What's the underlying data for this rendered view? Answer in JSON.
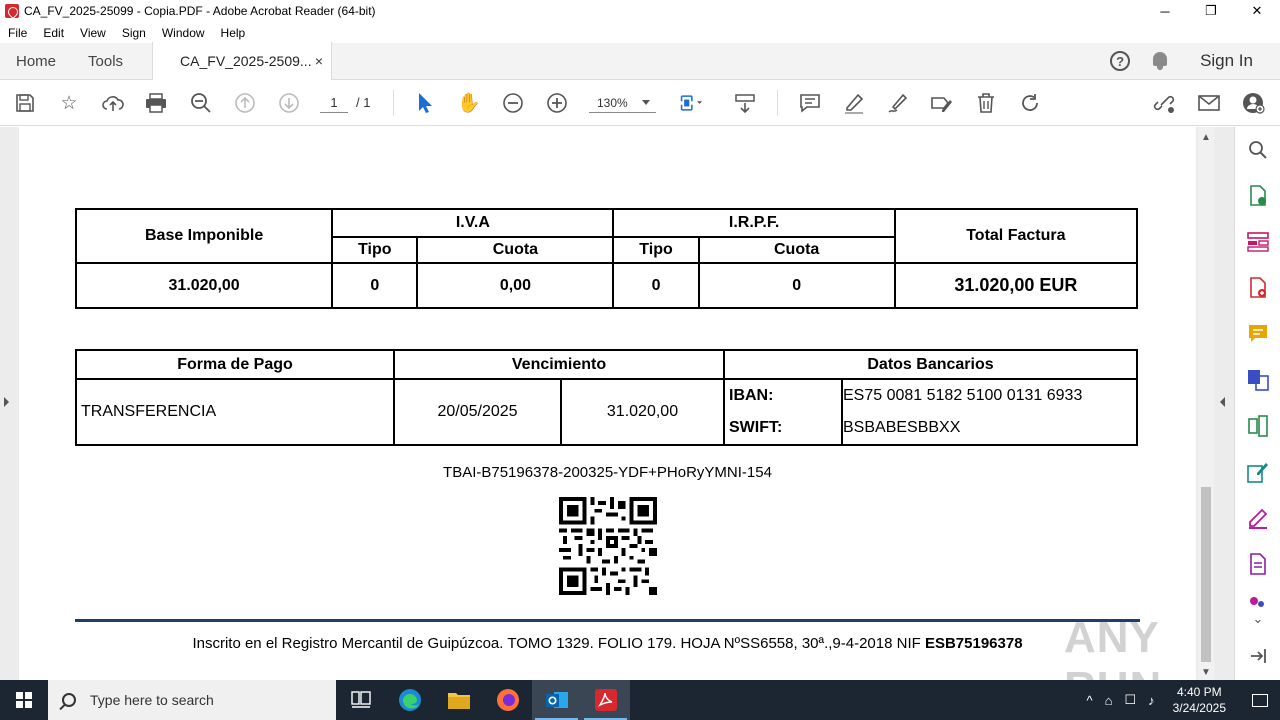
{
  "window": {
    "title": "CA_FV_2025-25099 - Copia.PDF - Adobe Acrobat Reader (64-bit)",
    "minimize": "─",
    "maximize": "❐",
    "close": "✕"
  },
  "menu": [
    "File",
    "Edit",
    "View",
    "Sign",
    "Window",
    "Help"
  ],
  "tabs": {
    "home": "Home",
    "tools": "Tools",
    "document": "CA_FV_2025-2509...",
    "close": "×",
    "sign_in": "Sign In",
    "help": "?"
  },
  "toolbar": {
    "page_current": "1",
    "page_total": "/ 1",
    "zoom": "130%"
  },
  "invoice": {
    "totals_header": {
      "base": "Base Imponible",
      "iva": "I.V.A",
      "irpf": "I.R.P.F.",
      "total": "Total Factura",
      "tipo": "Tipo",
      "cuota": "Cuota"
    },
    "totals_row": {
      "base": "31.020,00",
      "iva_tipo": "0",
      "iva_cuota": "0,00",
      "irpf_tipo": "0",
      "irpf_cuota": "0",
      "total": "31.020,00 EUR"
    },
    "payment_header": {
      "forma": "Forma de Pago",
      "vencimiento": "Vencimiento",
      "bancarios": "Datos Bancarios"
    },
    "payment_row": {
      "forma": "TRANSFERENCIA",
      "fecha": "20/05/2025",
      "importe": "31.020,00",
      "iban_label": "IBAN:",
      "iban": "ES75 0081 5182 5100 0131 6933",
      "swift_label": "SWIFT:",
      "swift": "BSBABESBBXX"
    },
    "tbai": "TBAI-B75196378-200325-YDF+PHoRyYMNI-154",
    "footer": "Inscrito en el Registro Mercantil de Guipúzcoa. TOMO 1329. FOLIO 179. HOJA  NºSS6558, 30ª.,9-4-2018 NIF",
    "footer_nif": "ESB75196378"
  },
  "watermark": "ANY RUN",
  "taskbar": {
    "search_placeholder": "Type here to search",
    "time": "4:40 PM",
    "date": "3/24/2025"
  }
}
